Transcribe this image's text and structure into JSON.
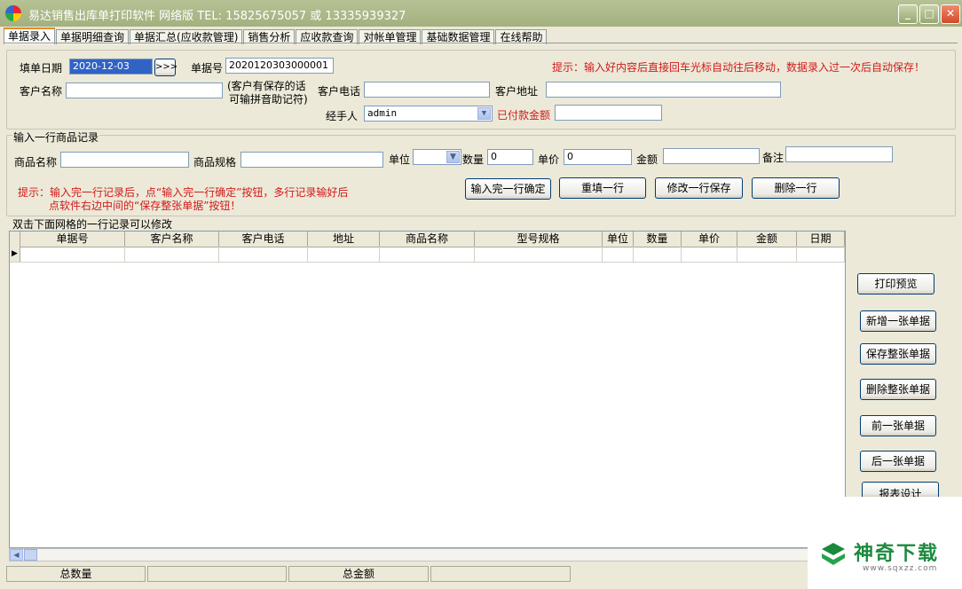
{
  "window": {
    "title": "易达销售出库单打印软件 网络版 TEL: 15825675057 或 13335939327"
  },
  "tabs": [
    "单据录入",
    "单据明细查询",
    "单据汇总(应收款管理)",
    "销售分析",
    "应收款查询",
    "对帐单管理",
    "基础数据管理",
    "在线帮助"
  ],
  "header_form": {
    "date_label": "填单日期",
    "date_value": "2020-12-03",
    "date_button": ">>>",
    "order_no_label": "单据号",
    "order_no_value": "2020120303000001",
    "hint": "提示：输入好内容后直接回车光标自动往后移动，数据录入过一次后自动保存！",
    "customer_name_label": "客户名称",
    "customer_name_value": "",
    "customer_note_line1": "(客户有保存的话",
    "customer_note_line2": "可输拼音助记符)",
    "customer_phone_label": "客户电话",
    "customer_phone_value": "",
    "customer_address_label": "客户地址",
    "customer_address_value": "",
    "handler_label": "经手人",
    "handler_value": "admin",
    "paid_label": "已付款金额",
    "paid_value": ""
  },
  "item_form": {
    "group_title": "输入一行商品记录",
    "name_label": "商品名称",
    "spec_label": "商品规格",
    "unit_label": "单位",
    "unit_value": "",
    "qty_label": "数量",
    "qty_value": "0",
    "price_label": "单价",
    "price_value": "0",
    "amount_label": "金额",
    "amount_value": "",
    "remark_label": "备注",
    "remark_value": "",
    "hint_line1": "提示：输入完一行记录后，点“输入完一行确定”按钮，多行记录输好后",
    "hint_line2": "点软件右边中间的“保存整张单据”按钮！",
    "buttons": {
      "confirm": "输入完一行确定",
      "refill": "重填一行",
      "modify": "修改一行保存",
      "delete": "删除一行"
    }
  },
  "grid": {
    "caption": "双击下面网格的一行记录可以修改",
    "columns": [
      "单据号",
      "客户名称",
      "客户电话",
      "地址",
      "商品名称",
      "型号规格",
      "单位",
      "数量",
      "单价",
      "金额",
      "日期"
    ],
    "row_indicator": "▶"
  },
  "side_buttons": {
    "print_preview": "打印预览",
    "new_order": "新增一张单据",
    "save_order": "保存整张单据",
    "delete_order": "删除整张单据",
    "prev_order": "前一张单据",
    "next_order": "后一张单据",
    "report_design": "报表设计"
  },
  "status_bar": {
    "total_qty_label": "总数量",
    "total_qty_value": "",
    "total_amount_label": "总金额",
    "total_amount_value": ""
  },
  "watermark": {
    "brand": "神奇下载",
    "url": "www.sqxzz.com"
  },
  "colors": {
    "title_bar": "#a3b07f",
    "hint_red": "#d21a1a",
    "selection_blue": "#3163c5",
    "watermark_green": "#1c8a3e"
  }
}
